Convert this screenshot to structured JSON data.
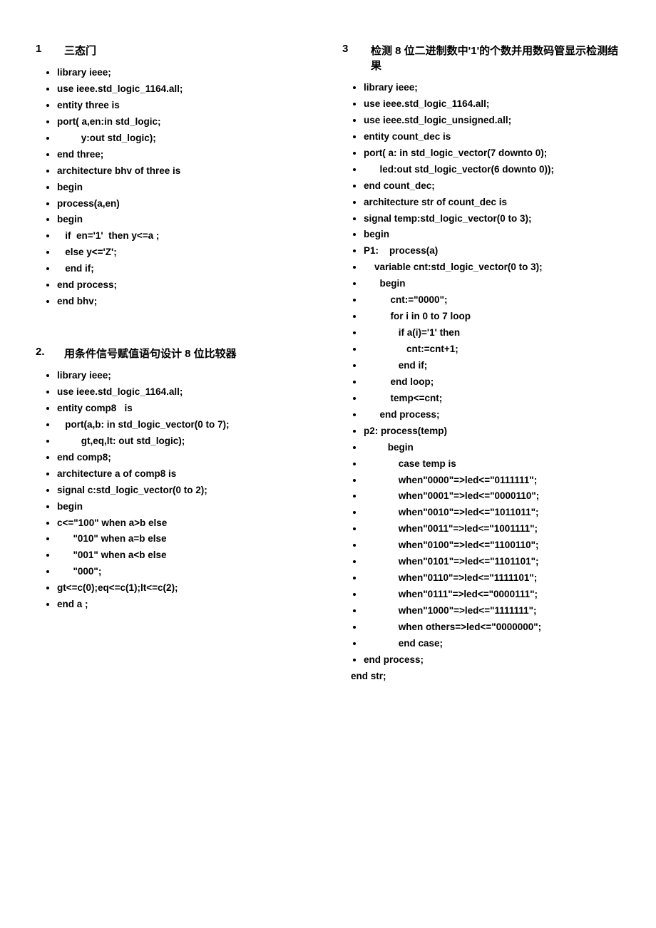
{
  "sections": {
    "s1": {
      "num": "1",
      "title": "三态门",
      "lines": [
        "library ieee;",
        "use ieee.std_logic_1164.all;",
        "entity three is",
        "port( a,en:in std_logic;",
        "         y:out std_logic);",
        "end three;",
        "architecture bhv of three is",
        "begin",
        "process(a,en)",
        "begin",
        "   if  en='1'  then y<=a ;",
        "   else y<='Z';",
        "   end if;",
        "end process;",
        "end bhv;"
      ]
    },
    "s2": {
      "num": "2.",
      "title": "用条件信号赋值语句设计 8 位比较器",
      "lines": [
        "library ieee;",
        "use ieee.std_logic_1164.all;",
        "entity comp8   is",
        "   port(a,b: in std_logic_vector(0 to 7);",
        "         gt,eq,lt: out std_logic);",
        "end comp8;",
        "architecture a of comp8 is",
        "signal c:std_logic_vector(0 to 2);",
        "begin",
        "c<=\"100\" when a>b else",
        "      \"010\" when a=b else",
        "      \"001\" when a<b else",
        "      \"000\";",
        "gt<=c(0);eq<=c(1);lt<=c(2);",
        "end a ;"
      ]
    },
    "s3": {
      "num": "3",
      "title": "检测 8 位二进制数中'1'的个数并用数码管显示检测结果",
      "lines": [
        "library ieee;",
        "use ieee.std_logic_1164.all;",
        "use ieee.std_logic_unsigned.all;",
        "entity count_dec is",
        "port( a: in std_logic_vector(7 downto 0);",
        "      led:out std_logic_vector(6 downto 0));",
        "end count_dec;",
        "architecture str of count_dec is",
        "signal temp:std_logic_vector(0 to 3);",
        "begin",
        "P1:    process(a)",
        "    variable cnt:std_logic_vector(0 to 3);",
        "      begin",
        "          cnt:=\"0000\";",
        "          for i in 0 to 7 loop",
        "             if a(i)='1' then",
        "                cnt:=cnt+1;",
        "             end if;",
        "          end loop;",
        "          temp<=cnt;",
        "      end process;",
        "p2: process(temp)",
        "         begin",
        "             case temp is",
        "             when\"0000\"=>led<=\"0111111\";",
        "             when\"0001\"=>led<=\"0000110\";",
        "             when\"0010\"=>led<=\"1011011\";",
        "             when\"0011\"=>led<=\"1001111\";",
        "             when\"0100\"=>led<=\"1100110\";",
        "             when\"0101\"=>led<=\"1101101\";",
        "             when\"0110\"=>led<=\"1111101\";",
        "             when\"0111\"=>led<=\"0000111\";",
        "             when\"1000\"=>led<=\"1111111\";",
        "             when others=>led<=\"0000000\";",
        "             end case;",
        "end process;",
        "end str;"
      ]
    }
  }
}
